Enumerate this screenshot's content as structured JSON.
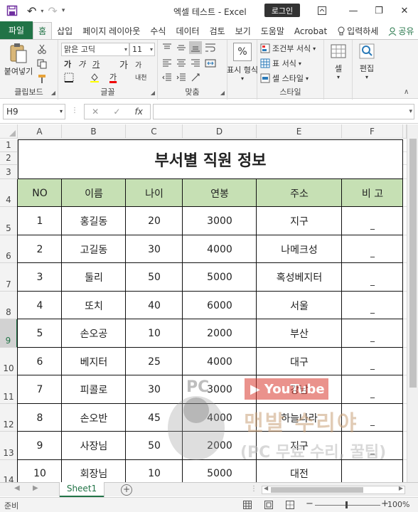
{
  "window": {
    "title": "엑셀 테스트  -  Excel",
    "login_label": "로그인",
    "minimize": "—",
    "restore": "❐",
    "close": "✕"
  },
  "qat": {
    "undo": "↶",
    "redo": "↷"
  },
  "tabs": [
    {
      "label": "파일"
    },
    {
      "label": "홈"
    },
    {
      "label": "삽입"
    },
    {
      "label": "페이지 레이아웃"
    },
    {
      "label": "수식"
    },
    {
      "label": "데이터"
    },
    {
      "label": "검토"
    },
    {
      "label": "보기"
    },
    {
      "label": "도움말"
    },
    {
      "label": "Acrobat"
    },
    {
      "label": "입력하세"
    },
    {
      "label": "공유"
    }
  ],
  "ribbon": {
    "clipboard": {
      "paste": "붙여넣기",
      "label": "클립보드"
    },
    "font": {
      "name": "맑은 고딕",
      "size": "11",
      "label": "글꼴",
      "bold": "가",
      "italic": "가",
      "underline": "가",
      "grow": "가",
      "shrink": "가",
      "fontcolor": "가",
      "phonetic": "내천"
    },
    "align": {
      "label": "맞춤"
    },
    "number": {
      "label": "표시 형식",
      "percent": "%"
    },
    "styles": {
      "cond": "조건부 서식",
      "table": "표 서식",
      "cell": "셀 스타일",
      "label": "스타일"
    },
    "cells": {
      "label": "셀"
    },
    "edit": {
      "label": "편집"
    }
  },
  "formula_bar": {
    "name_box": "H9",
    "cancel": "✕",
    "enter": "✓",
    "fx": "fx",
    "formula": ""
  },
  "columns": [
    "A",
    "B",
    "C",
    "D",
    "E",
    "F"
  ],
  "rows": [
    "1",
    "2",
    "3",
    "4",
    "5",
    "6",
    "7",
    "8",
    "9",
    "10",
    "11",
    "12",
    "13",
    "14"
  ],
  "sheet": {
    "title": "부서별 직원 정보",
    "headers": [
      "NO",
      "이름",
      "나이",
      "연봉",
      "주소",
      "비 고"
    ],
    "data": [
      [
        "1",
        "홍길동",
        "20",
        "3000",
        "지구",
        "_"
      ],
      [
        "2",
        "고길동",
        "30",
        "4000",
        "나메크성",
        "_"
      ],
      [
        "3",
        "둘리",
        "50",
        "5000",
        "혹성베지터",
        "_"
      ],
      [
        "4",
        "또치",
        "40",
        "6000",
        "서울",
        "_"
      ],
      [
        "5",
        "손오공",
        "10",
        "2000",
        "부산",
        "_"
      ],
      [
        "6",
        "베지터",
        "25",
        "4000",
        "대구",
        "_"
      ],
      [
        "7",
        "피콜로",
        "30",
        "3000",
        "강남",
        "_"
      ],
      [
        "8",
        "손오반",
        "45",
        "4000",
        "하늘나라",
        "_"
      ],
      [
        "9",
        "사장님",
        "50",
        "2000",
        "지구",
        "_"
      ],
      [
        "10",
        "회장님",
        "10",
        "5000",
        "대전",
        ""
      ]
    ]
  },
  "watermark": {
    "pc": "PC",
    "yt": "YouTube",
    "line1": "맨발 수리야",
    "line2": "(PC 무료 수리, 꿀팁)"
  },
  "sheet_tabs": {
    "active": "Sheet1",
    "add": "+"
  },
  "status": {
    "ready": "준비",
    "zoom": "100%",
    "zoom_out": "−",
    "zoom_in": "+"
  },
  "colors": {
    "accent": "#217346",
    "header_fill": "#c6e0b4"
  }
}
